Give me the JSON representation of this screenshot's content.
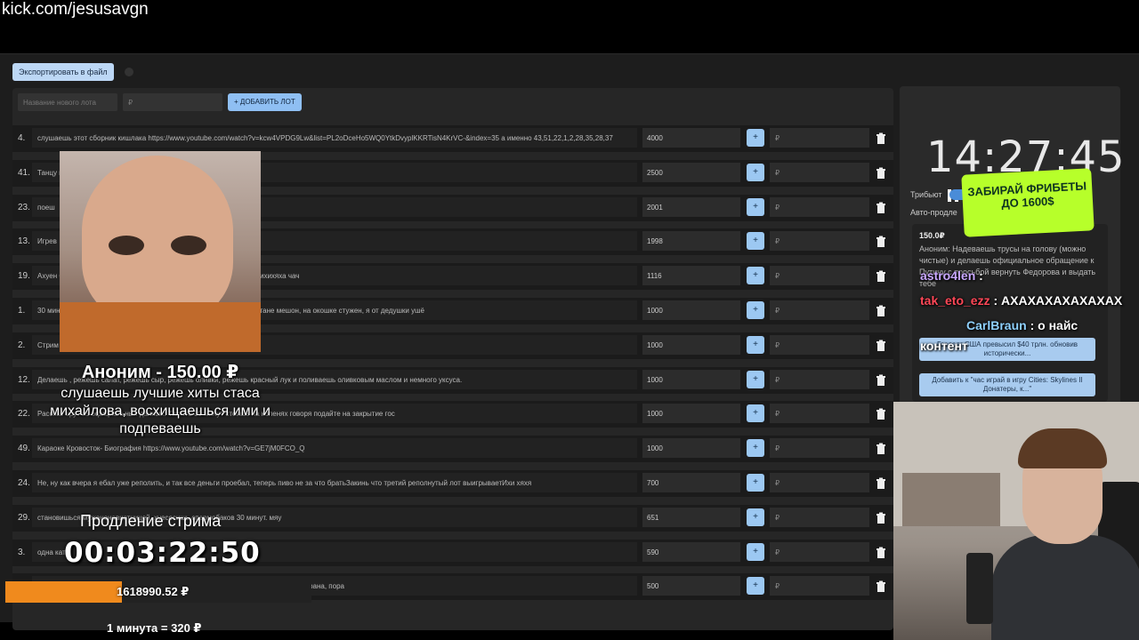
{
  "url": "kick.com/jesusavgn",
  "toolbar": {
    "export_label": "Экспортировать в файл"
  },
  "add_lot": {
    "name_placeholder": "Название нового лота",
    "amount_placeholder": "₽",
    "add_label": "+ ДОБАВИТЬ ЛОТ"
  },
  "lots": [
    {
      "num": "4.",
      "text": "слушаешь этот сборник кишлака https://www.youtube.com/watch?v=kcw4VPDG9Lw&list=PL2oDceHo5WQ0YtkDvyplKKRTisN4KrVC-&index=35 а именно 43,51,22,1,2,28,35,28,37",
      "amount": "4000"
    },
    {
      "num": "41.",
      "text": "Танцу                                                                  крылышки / какашки мне в кармашки",
      "amount": "2500"
    },
    {
      "num": "23.",
      "text": "поеш",
      "amount": "2001"
    },
    {
      "num": "13.",
      "text": "Игрев",
      "amount": "1998"
    },
    {
      "num": "19.",
      "text": "Ахуен                                                                  башить. вртой. по. лыгыдышкам. Лыгыдышкам крылышкам. ихихяха чач",
      "amount": "1116"
    },
    {
      "num": "1.",
      "text": "30 минут                                                                  и говоришь: я по коробу скребен, по сусеку метен, на сметане мешон, на окошке стужен, я от дедушки ушё",
      "amount": "1000"
    },
    {
      "num": "2.",
      "text": "Стрим",
      "amount": "1000"
    },
    {
      "num": "12.",
      "text": "Делаешь                                                          , режешь салат, режешь сыр, режешь оливки, режешь красный лук и поливаешь оливковым маслом и немного уксуса.",
      "amount": "1000"
    },
    {
      "num": "22.",
      "text": "Рассказ                                                                  ерут из официальных данных. Так что 30 минут стоишь на коленях говоря подайте на закрытие гос",
      "amount": "1000"
    },
    {
      "num": "49.",
      "text": "Караоке Кровосток- Биография https://www.youtube.com/watch?v=GE7jM0FCO_Q",
      "amount": "1000"
    },
    {
      "num": "24.",
      "text": "Не, ну как вчера я ебал уже реполить, и так все деньги проебал, теперь пиво не за что братьЗакинь что третий реполнутый лот выигрываетИхи хяхя",
      "amount": "700"
    },
    {
      "num": "29.",
      "text": "становишься мужененавистницей, хуесосишь спермобаков 30 минут. мяу",
      "amount": "651"
    },
    {
      "num": "3.",
      "text": "одна кат",
      "amount": "590"
    },
    {
      "num": "14.",
      "text": "                                                                                          можно не покупать, но говоришь что очень хочешь вернуться, америка грязная страна, пора",
      "amount": "500"
    }
  ],
  "rub_placeholder": "₽",
  "right": {
    "clock": "14:27:45",
    "tribute_label": "Трибьют",
    "auto_label": "Авто-продле",
    "card_amount": "150.0₽",
    "card_text": "Аноним: Надеваешь трусы на голову (можно чистые) и делаешь официальное обращение к Путину с просьбой вернуть Федорова и выдать тебе",
    "card_btn1": "Госдолг США превысил $40 трлн. обновив исторически...",
    "card_btn2": "Добавить к \"час играй в игру Cities: Skylines II Донатеры, к...\""
  },
  "promo": "ЗАБИРАЙ ФРИБЕТЫ ДО 1600$",
  "chat": [
    {
      "name": "astro4len",
      "text": ":"
    },
    {
      "name": "tak_eto_ezz",
      "text": ": АХАХАХАХАХАХАХ"
    },
    {
      "name": "CarlBraun",
      "text": ": о найс"
    },
    {
      "name": "",
      "text": "контент"
    }
  ],
  "donation": {
    "title": "Аноним - 150.00 ₽",
    "message": "слушаешь лучшие хиты стаса михайлова, восхищаешься ими и подпеваешь"
  },
  "extension": {
    "label": "Продление стрима",
    "timer": "00:03:22:50",
    "total": "1618990.52 ₽",
    "progress": 0.38,
    "rate": "1 минута = 320 ₽"
  },
  "colors": {
    "accent": "#8fbff3",
    "progress": "#f08a1d",
    "promo": "#b7ff2a"
  }
}
